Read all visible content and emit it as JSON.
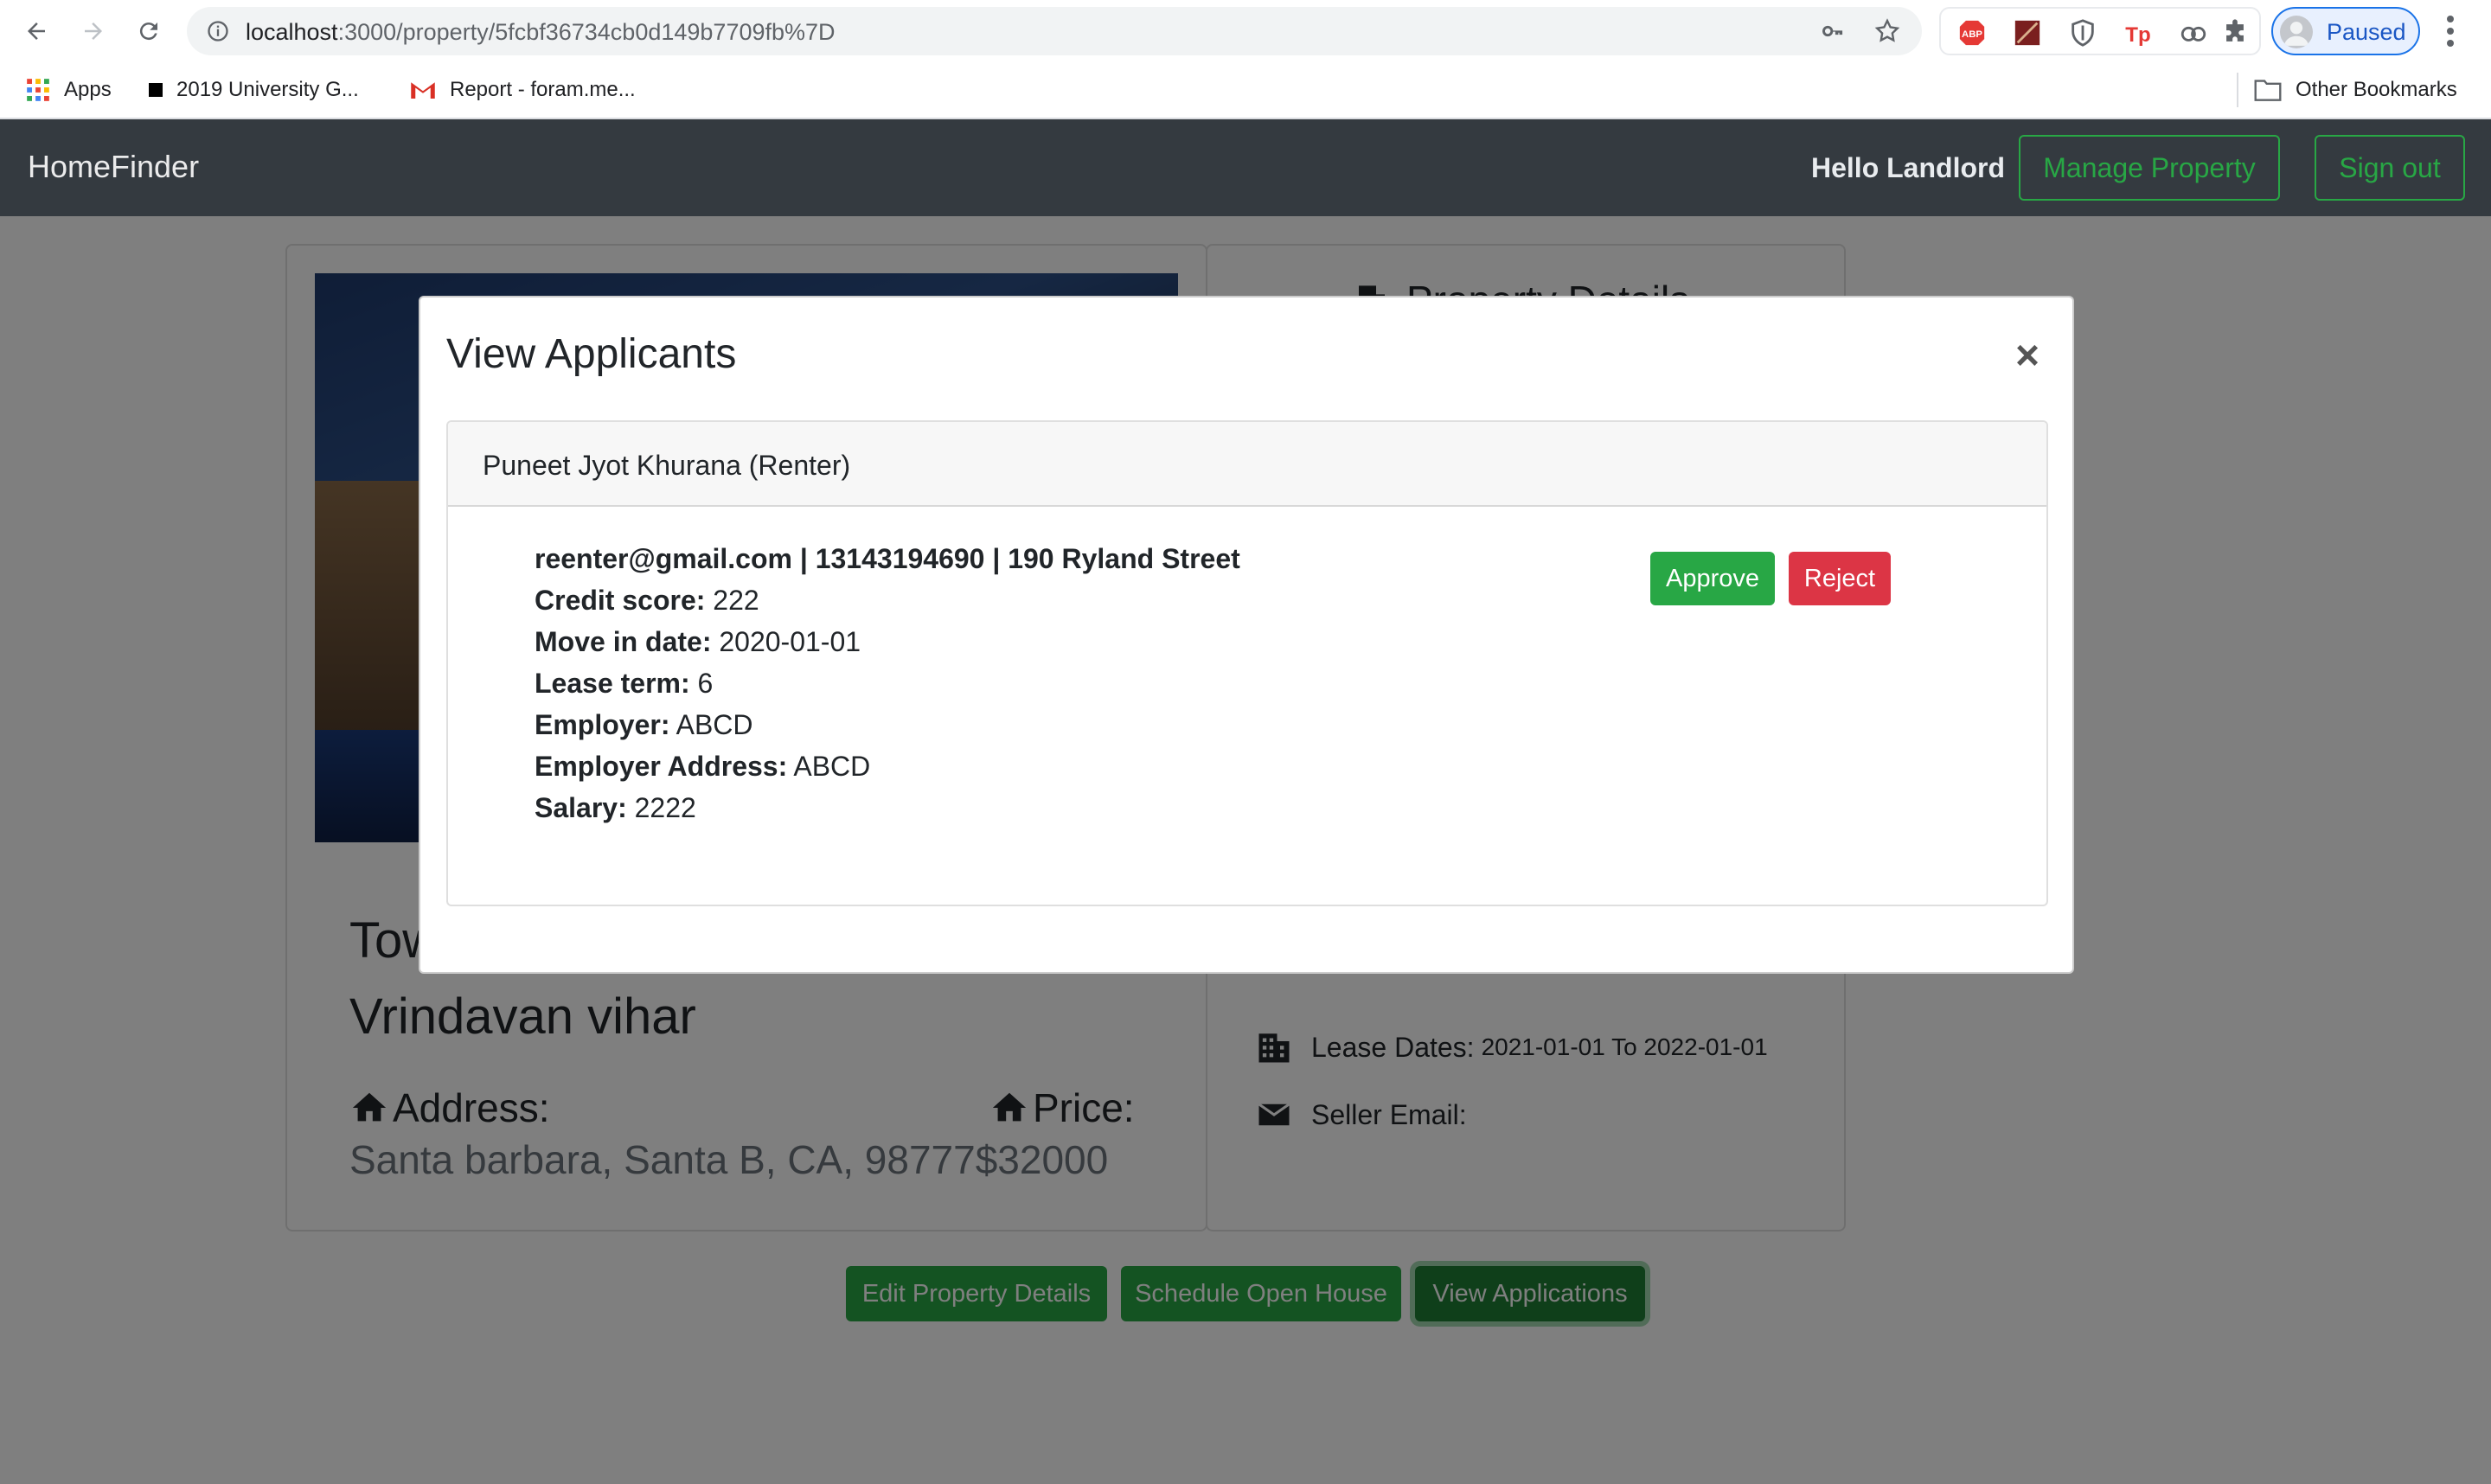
{
  "browser": {
    "url_host": "localhost",
    "url_path": ":3000/property/5fcbf36734cb0d149b7709fb%7D",
    "profile_label": "Paused",
    "bookmarks": [
      {
        "label": "Apps"
      },
      {
        "label": "2019 University G..."
      },
      {
        "label": "Report - foram.me..."
      }
    ],
    "other_bookmarks": "Other Bookmarks",
    "extensions": [
      "adblock-icon",
      "extension-icon",
      "shield-icon",
      "tp-icon",
      "cloud-icon",
      "puzzle-icon"
    ]
  },
  "navbar": {
    "brand": "HomeFinder",
    "greeting": "Hello Landlord",
    "manage_property": "Manage Property",
    "sign_out": "Sign out"
  },
  "property": {
    "title_line1": "Tow",
    "title_line2": "Vrindavan vihar",
    "address_label": "Address:",
    "price_label": "Price:",
    "address_value": "Santa barbara, Santa B, CA, 98777$32000"
  },
  "details": {
    "title": "Property Details",
    "lease_dates_label": "Lease Dates:",
    "lease_dates_value": "2021-01-01 To 2022-01-01",
    "seller_email_label": "Seller Email:"
  },
  "actions": {
    "edit": "Edit Property Details",
    "schedule": "Schedule Open House",
    "view_applications": "View Applications"
  },
  "modal": {
    "title": "View Applicants",
    "close": "×",
    "applicant": {
      "header": "Puneet Jyot Khurana (Renter)",
      "contact": "reenter@gmail.com | 13143194690 | 190 Ryland Street",
      "fields": [
        {
          "label": "Credit score:",
          "value": "222"
        },
        {
          "label": "Move in date:",
          "value": "2020-01-01"
        },
        {
          "label": "Lease term:",
          "value": "6"
        },
        {
          "label": "Employer:",
          "value": "ABCD"
        },
        {
          "label": "Employer Address:",
          "value": "ABCD"
        },
        {
          "label": "Salary:",
          "value": "2222"
        }
      ],
      "approve": "Approve",
      "reject": "Reject"
    }
  },
  "colors": {
    "navbar_bg": "#343a40",
    "success": "#28a745",
    "danger": "#dc3545",
    "accent_blue": "#1a73e8"
  }
}
